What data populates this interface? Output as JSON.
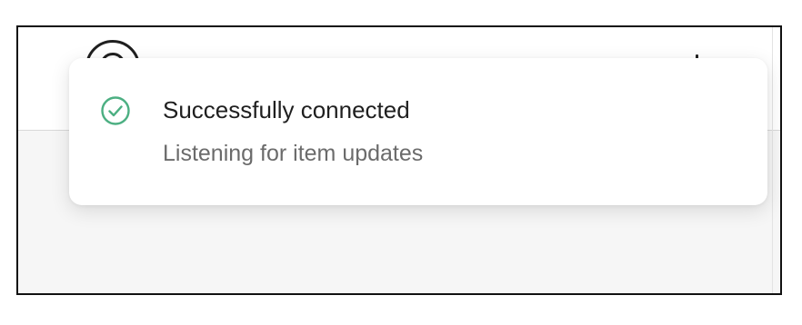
{
  "header": {
    "logo_icon": "circle-logo-icon"
  },
  "toast": {
    "status_icon": "check-circle-icon",
    "status_color": "#4caf82",
    "title": "Successfully connected",
    "description": "Listening for item updates"
  }
}
